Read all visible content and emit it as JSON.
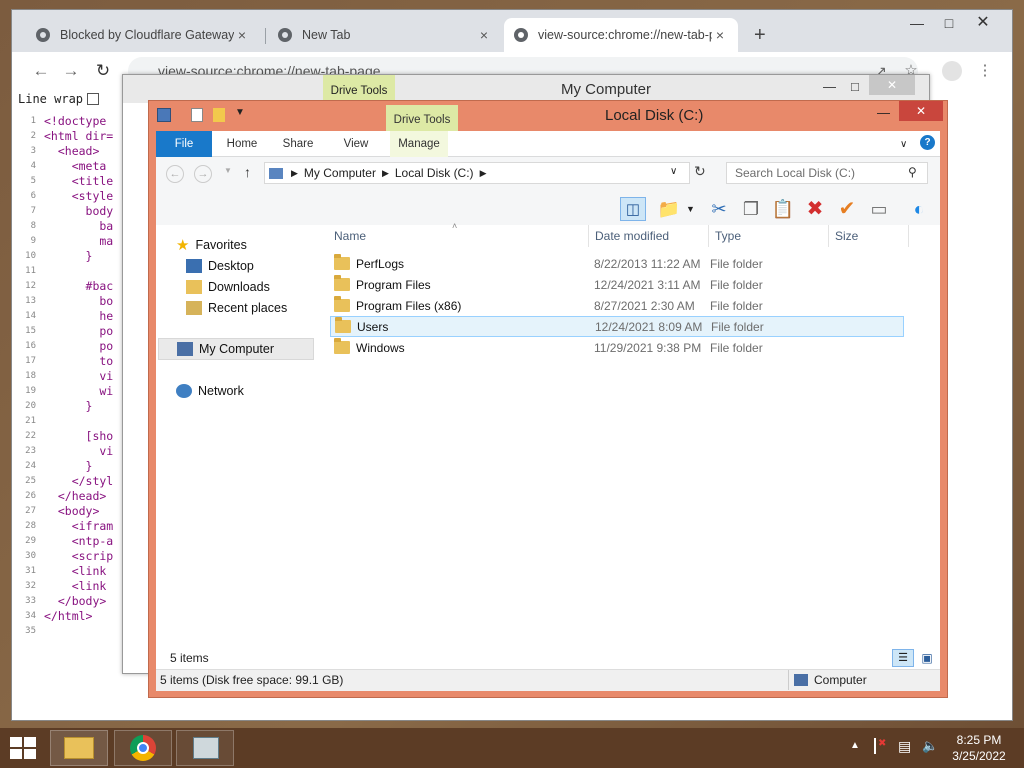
{
  "chrome": {
    "tabs": [
      {
        "label": "Blocked by Cloudflare Gateway"
      },
      {
        "label": "New Tab"
      },
      {
        "label": "view-source:chrome://new-tab-p"
      }
    ],
    "new_tab_symbol": "+",
    "close_symbol": "×",
    "address": "view-source:chrome://new-tab-page",
    "line_wrap_label": "Line wrap",
    "source_lines": [
      "<!doctype",
      "<html dir=",
      "  <head>",
      "    <meta",
      "    <title",
      "    <style",
      "      body",
      "        ba",
      "        ma",
      "      }",
      "",
      "      #bac",
      "        bo",
      "        he",
      "        po",
      "        po",
      "        to",
      "        vi",
      "        wi",
      "      }",
      "",
      "      [sho",
      "        vi",
      "      }",
      "    </styl",
      "  </head>",
      "  <body>",
      "    <ifram",
      "    <ntp-a",
      "    <scrip",
      "    <link",
      "    <link",
      "  </body>",
      "</html>",
      ""
    ]
  },
  "mycomputer": {
    "title": "My Computer",
    "drive_tools": "Drive Tools"
  },
  "localdisk": {
    "title": "Local Disk (C:)",
    "drive_tools": "Drive Tools",
    "ribbon_tabs": [
      "File",
      "Home",
      "Share",
      "View",
      "Manage"
    ],
    "breadcrumb": [
      "My Computer",
      "Local Disk (C:)"
    ],
    "search_placeholder": "Search Local Disk (C:)",
    "nav": {
      "favorites": "Favorites",
      "desktop": "Desktop",
      "downloads": "Downloads",
      "recent": "Recent places",
      "mycomputer": "My Computer",
      "network": "Network"
    },
    "columns": [
      "Name",
      "Date modified",
      "Type",
      "Size"
    ],
    "rows": [
      {
        "name": "PerfLogs",
        "date": "8/22/2013 11:22 AM",
        "type": "File folder"
      },
      {
        "name": "Program Files",
        "date": "12/24/2021 3:11 AM",
        "type": "File folder"
      },
      {
        "name": "Program Files (x86)",
        "date": "8/27/2021 2:30 AM",
        "type": "File folder"
      },
      {
        "name": "Users",
        "date": "12/24/2021 8:09 AM",
        "type": "File folder"
      },
      {
        "name": "Windows",
        "date": "11/29/2021 9:38 PM",
        "type": "File folder"
      }
    ],
    "item_count": "5 items",
    "status_left": "5 items (Disk free space: 99.1 GB)",
    "status_right": "Computer"
  },
  "taskbar": {
    "time": "8:25 PM",
    "date": "3/25/2022"
  }
}
